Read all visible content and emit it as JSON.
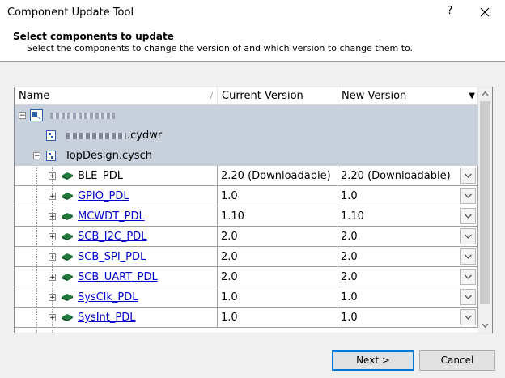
{
  "window": {
    "title": "Component Update Tool",
    "help_label": "?"
  },
  "header": {
    "title": "Select components to update",
    "subtitle": "Select the components to change the version of and which version to change them to."
  },
  "grid": {
    "columns": [
      "Name",
      "Current Version",
      "New Version"
    ],
    "group_rows": [
      {
        "name": ""
      },
      {
        "name": ".cydwr"
      },
      {
        "name": "TopDesign.cysch"
      }
    ],
    "rows": [
      {
        "name": "BLE_PDL",
        "current": "2.20 (Downloadable)",
        "new": "2.20 (Downloadable)",
        "link": false
      },
      {
        "name": "GPIO_PDL",
        "current": "1.0",
        "new": "1.0",
        "link": true
      },
      {
        "name": "MCWDT_PDL",
        "current": "1.10",
        "new": "1.10",
        "link": true
      },
      {
        "name": "SCB_I2C_PDL",
        "current": "2.0",
        "new": "2.0",
        "link": true
      },
      {
        "name": "SCB_SPI_PDL",
        "current": "2.0",
        "new": "2.0",
        "link": true
      },
      {
        "name": "SCB_UART_PDL",
        "current": "2.0",
        "new": "2.0",
        "link": true
      },
      {
        "name": "SysClk_PDL",
        "current": "1.0",
        "new": "1.0",
        "link": true
      },
      {
        "name": "SysInt_PDL",
        "current": "1.0",
        "new": "1.0",
        "link": true
      }
    ]
  },
  "buttons": {
    "next": "Next >",
    "cancel": "Cancel"
  },
  "colors": {
    "group_bg": "#c8d0dc",
    "link": "#0000cc",
    "chip": "#1f7a3a"
  }
}
